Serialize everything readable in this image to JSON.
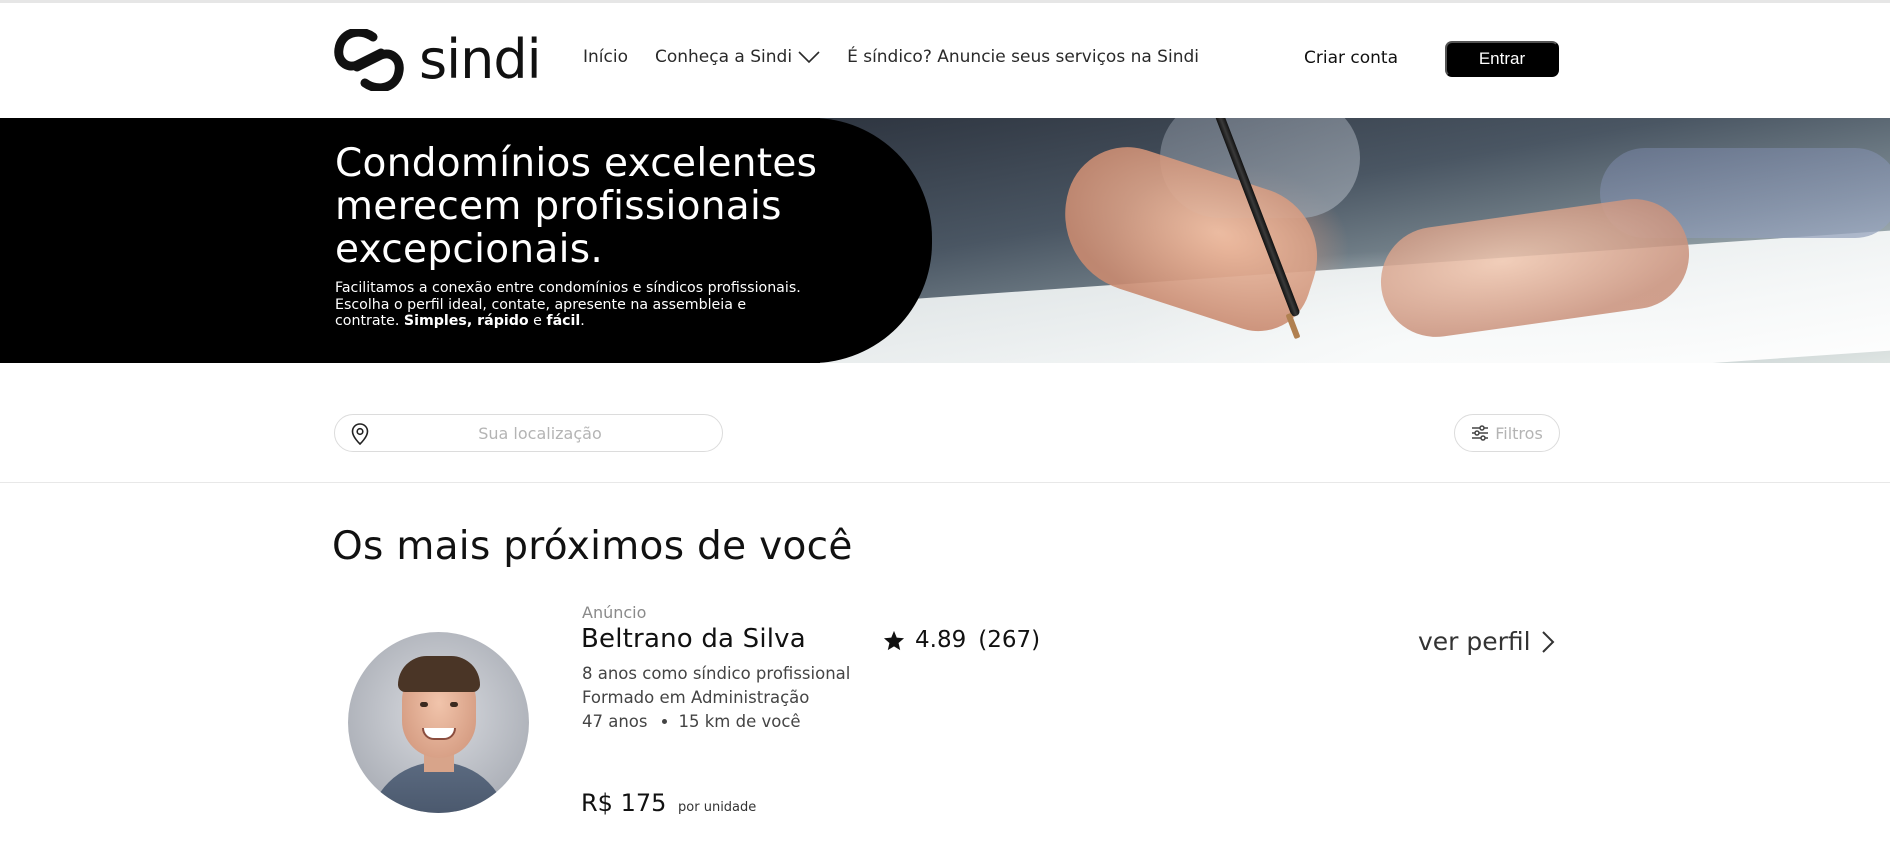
{
  "brand": {
    "name": "sindi"
  },
  "nav": {
    "inicio": "Início",
    "conheca": "Conheça a Sindi",
    "anuncie": "É síndico? Anuncie seus serviços na Sindi"
  },
  "auth": {
    "criar_conta": "Criar conta",
    "entrar": "Entrar"
  },
  "hero": {
    "title": "Condomínios excelentes merecem profissionais excepcionais.",
    "subtitle_prefix": "Facilitamos a conexão entre condomínios e síndicos profissionais. Escolha o perfil ideal, contate, apresente na assembleia e contrate. ",
    "subtitle_bold_1": "Simples, rápido",
    "subtitle_mid": " e ",
    "subtitle_bold_2": "fácil",
    "subtitle_end": "."
  },
  "search": {
    "placeholder": "Sua localização",
    "value": ""
  },
  "filters": {
    "label": "Filtros"
  },
  "section": {
    "title": "Os mais próximos de você"
  },
  "listing": {
    "tag": "Anúncio",
    "name": "Beltrano da Silva",
    "rating": "4.89",
    "reviews": "(267)",
    "experience": "8 anos como síndico profissional",
    "education": "Formado em Administração",
    "age": "47 anos",
    "distance": "15 km de você",
    "price": "R$ 175",
    "price_unit": "por unidade",
    "profile_link": "ver perfil"
  },
  "icons": {
    "logo": "sindi-logo-icon",
    "dropdown": "chevron-down-icon",
    "location": "location-pin-icon",
    "filters": "sliders-icon",
    "star": "star-icon",
    "next": "chevron-right-icon"
  }
}
